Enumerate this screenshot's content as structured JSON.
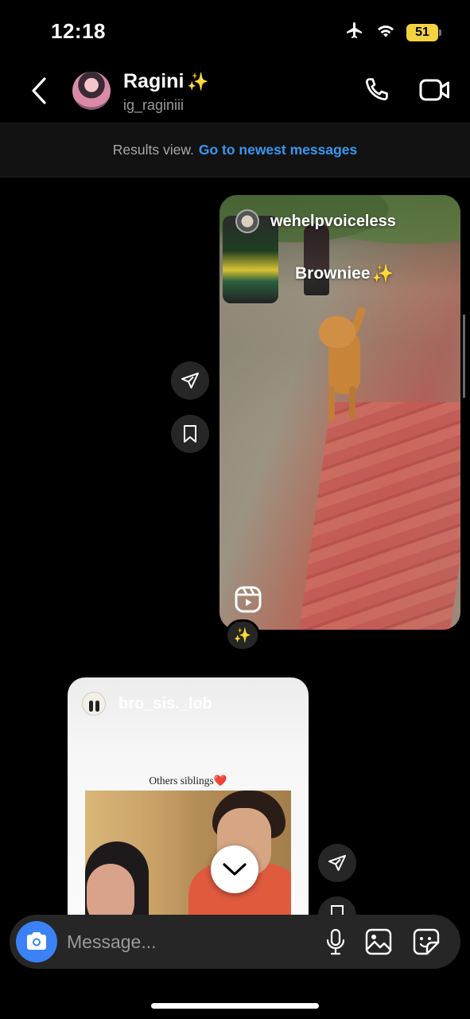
{
  "status_bar": {
    "time": "12:18",
    "battery": "51",
    "icons": [
      "airplane-icon",
      "wifi-icon",
      "battery-icon"
    ]
  },
  "header": {
    "contact_name": "Ragini",
    "name_emoji": "✨",
    "contact_handle": "ig_raginiii",
    "icons": [
      "back-chevron-icon",
      "phone-icon",
      "video-camera-icon"
    ]
  },
  "results_banner": {
    "text": "Results view.",
    "link": "Go to newest messages"
  },
  "reel_message": {
    "author": "wehelpvoiceless",
    "caption": "Browniee",
    "caption_emoji": "✨",
    "reaction": "✨",
    "icons": [
      "reel-icon",
      "share-icon",
      "bookmark-icon"
    ]
  },
  "post_message": {
    "author": "bro_sis._lob",
    "caption": "Others siblings",
    "caption_emoji": "❤️",
    "icons": [
      "share-icon",
      "bookmark-icon"
    ]
  },
  "composer": {
    "placeholder": "Message...",
    "icons": [
      "camera-icon",
      "microphone-icon",
      "gallery-icon",
      "sticker-icon"
    ]
  },
  "colors": {
    "background": "#000000",
    "link": "#3897f0",
    "camera_button": "#3b82f6",
    "bubble_dark": "#262626",
    "battery": "#f3d33f"
  }
}
